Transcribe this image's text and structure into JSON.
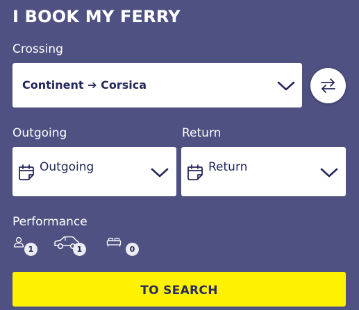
{
  "title": "I BOOK MY FERRY",
  "crossing": {
    "label": "Crossing",
    "value": "Continent ➔ Corsica"
  },
  "outgoing": {
    "label": "Outgoing",
    "placeholder": "Outgoing"
  },
  "return": {
    "label": "Return",
    "placeholder": "Return"
  },
  "performance": {
    "label": "Performance",
    "passengers": "1",
    "vehicles": "1",
    "cabins": "0"
  },
  "search_label": "TO SEARCH",
  "colors": {
    "background": "#4f5183",
    "accent": "#fff200",
    "text_dark": "#23265a"
  },
  "icons": [
    "swap-icon",
    "calendar-icon",
    "person-icon",
    "car-icon",
    "bed-icon",
    "chevron-down-icon"
  ]
}
